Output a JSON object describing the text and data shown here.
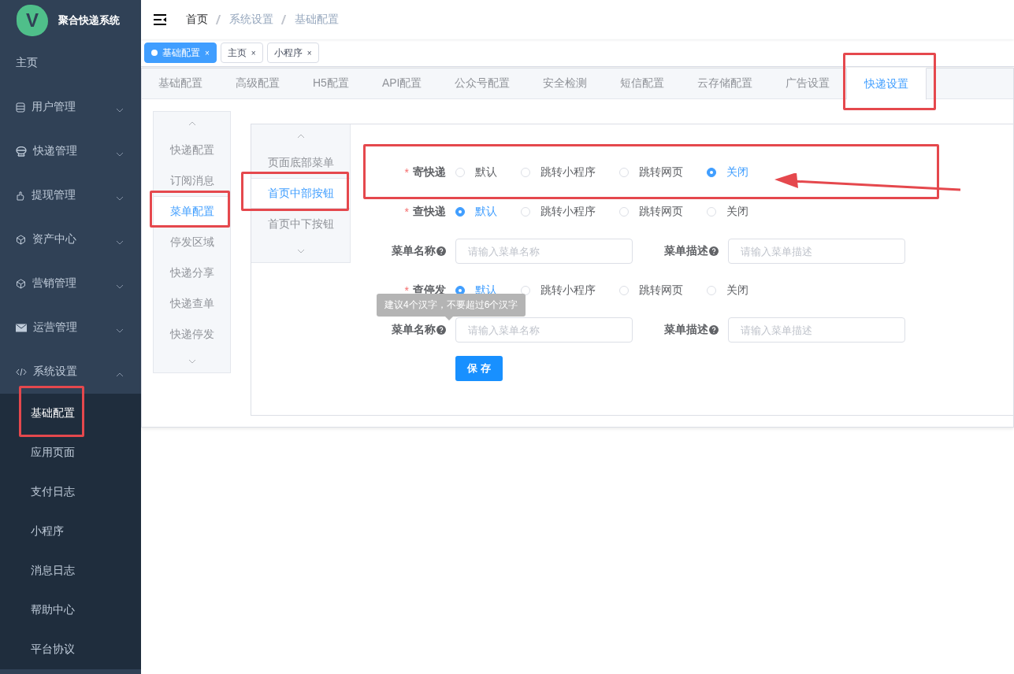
{
  "sidebar": {
    "logo_letter": "V",
    "title": "聚合快递系统",
    "items": [
      {
        "label": "主页",
        "kind": "link"
      },
      {
        "label": "用户管理",
        "kind": "group",
        "expanded": false
      },
      {
        "label": "快递管理",
        "kind": "group",
        "expanded": false
      },
      {
        "label": "提现管理",
        "kind": "group",
        "expanded": false
      },
      {
        "label": "资产中心",
        "kind": "group",
        "expanded": false
      },
      {
        "label": "营销管理",
        "kind": "group",
        "expanded": false
      },
      {
        "label": "运营管理",
        "kind": "group",
        "expanded": false
      },
      {
        "label": "系统设置",
        "kind": "group",
        "expanded": true,
        "children": [
          {
            "label": "基础配置",
            "selected": true,
            "highlighted": true
          },
          {
            "label": "应用页面",
            "selected": false,
            "highlighted": false
          },
          {
            "label": "支付日志",
            "selected": false,
            "highlighted": false
          },
          {
            "label": "小程序",
            "selected": false,
            "highlighted": false
          },
          {
            "label": "消息日志",
            "selected": false,
            "highlighted": false
          },
          {
            "label": "帮助中心",
            "selected": false,
            "highlighted": false
          },
          {
            "label": "平台协议",
            "selected": false,
            "highlighted": false
          }
        ]
      }
    ]
  },
  "breadcrumb": [
    "首页",
    "系统设置",
    "基础配置"
  ],
  "tags": [
    {
      "label": "基础配置",
      "close": "×",
      "selected": true
    },
    {
      "label": "主页",
      "close": "×",
      "selected": false
    },
    {
      "label": "小程序",
      "close": "×",
      "selected": false
    }
  ],
  "tabs": [
    {
      "label": "基础配置",
      "selected": false,
      "highlighted": false
    },
    {
      "label": "高级配置",
      "selected": false,
      "highlighted": false
    },
    {
      "label": "H5配置",
      "selected": false,
      "highlighted": false
    },
    {
      "label": "API配置",
      "selected": false,
      "highlighted": false
    },
    {
      "label": "公众号配置",
      "selected": false,
      "highlighted": false
    },
    {
      "label": "安全检测",
      "selected": false,
      "highlighted": false
    },
    {
      "label": "短信配置",
      "selected": false,
      "highlighted": false
    },
    {
      "label": "云存储配置",
      "selected": false,
      "highlighted": false
    },
    {
      "label": "广告设置",
      "selected": false,
      "highlighted": false
    },
    {
      "label": "快递设置",
      "selected": true,
      "highlighted": true
    }
  ],
  "side_nav": [
    {
      "label": "快递配置",
      "selected": false,
      "highlighted": false
    },
    {
      "label": "订阅消息",
      "selected": false,
      "highlighted": false
    },
    {
      "label": "菜单配置",
      "selected": true,
      "highlighted": true
    },
    {
      "label": "停发区域",
      "selected": false,
      "highlighted": false
    },
    {
      "label": "快递分享",
      "selected": false,
      "highlighted": false
    },
    {
      "label": "快递查单",
      "selected": false,
      "highlighted": false
    },
    {
      "label": "快递停发",
      "selected": false,
      "highlighted": false
    }
  ],
  "sub_nav": [
    {
      "label": "页面底部菜单",
      "selected": false,
      "highlighted": false
    },
    {
      "label": "首页中部按钮",
      "selected": true,
      "highlighted": true
    },
    {
      "label": "首页中下按钮",
      "selected": false,
      "highlighted": false
    }
  ],
  "form": {
    "rows": [
      {
        "kind": "radio",
        "marker": "*",
        "label": "寄快递",
        "highlighted": true,
        "options": [
          {
            "label": "默认",
            "selected": false
          },
          {
            "label": "跳转小程序",
            "selected": false
          },
          {
            "label": "跳转网页",
            "selected": false
          },
          {
            "label": "关闭",
            "selected": true
          }
        ]
      },
      {
        "kind": "radio",
        "marker": "*",
        "label": "查快递",
        "highlighted": false,
        "options": [
          {
            "label": "默认",
            "selected": true
          },
          {
            "label": "跳转小程序",
            "selected": false
          },
          {
            "label": "跳转网页",
            "selected": false
          },
          {
            "label": "关闭",
            "selected": false
          }
        ]
      },
      {
        "kind": "inputs",
        "fields": [
          {
            "label": "菜单名称",
            "placeholder": "请输入菜单名称"
          },
          {
            "label": "菜单描述",
            "placeholder": "请输入菜单描述"
          }
        ]
      },
      {
        "kind": "radio",
        "marker": "*",
        "label": "查停发",
        "highlighted": false,
        "options": [
          {
            "label": "默认",
            "selected": true
          },
          {
            "label": "跳转小程序",
            "selected": false
          },
          {
            "label": "跳转网页",
            "selected": false
          },
          {
            "label": "关闭",
            "selected": false
          }
        ]
      },
      {
        "kind": "inputs",
        "fields": [
          {
            "label": "菜单名称",
            "placeholder": "请输入菜单名称",
            "tooltip": "建议4个汉字，不要超过6个汉字"
          },
          {
            "label": "菜单描述",
            "placeholder": "请输入菜单描述"
          }
        ]
      }
    ],
    "save": "保 存"
  }
}
